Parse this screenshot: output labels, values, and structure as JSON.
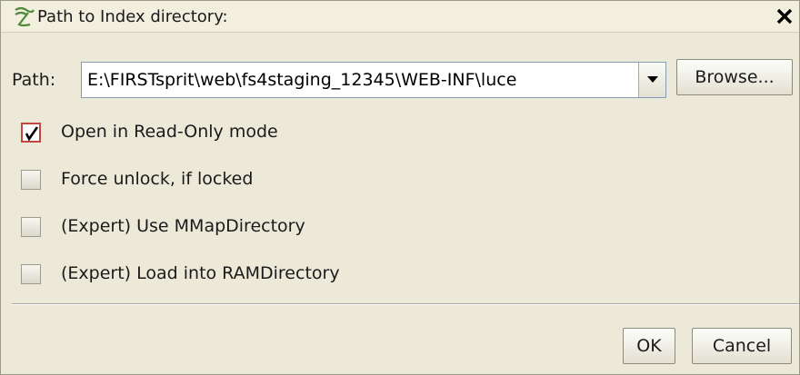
{
  "dialog": {
    "title": "Path to Index directory:",
    "close_icon": "close-icon",
    "title_icon": "index-directory-icon"
  },
  "path": {
    "label": "Path:",
    "value": "E:\\FIRSTsprit\\web\\fs4staging_12345\\WEB-INF\\luce",
    "dropdown_icon": "chevron-down-icon",
    "browse_label": "Browse..."
  },
  "options": [
    {
      "label": "Open in Read-Only mode",
      "checked": true
    },
    {
      "label": "Force unlock, if locked",
      "checked": false
    },
    {
      "label": "(Expert) Use MMapDirectory",
      "checked": false
    },
    {
      "label": "(Expert) Load into RAMDirectory",
      "checked": false
    }
  ],
  "footer": {
    "ok_label": "OK",
    "cancel_label": "Cancel"
  },
  "colors": {
    "background": "#ece9d8",
    "check_border": "#c4463c",
    "field_border": "#7f9db9"
  }
}
